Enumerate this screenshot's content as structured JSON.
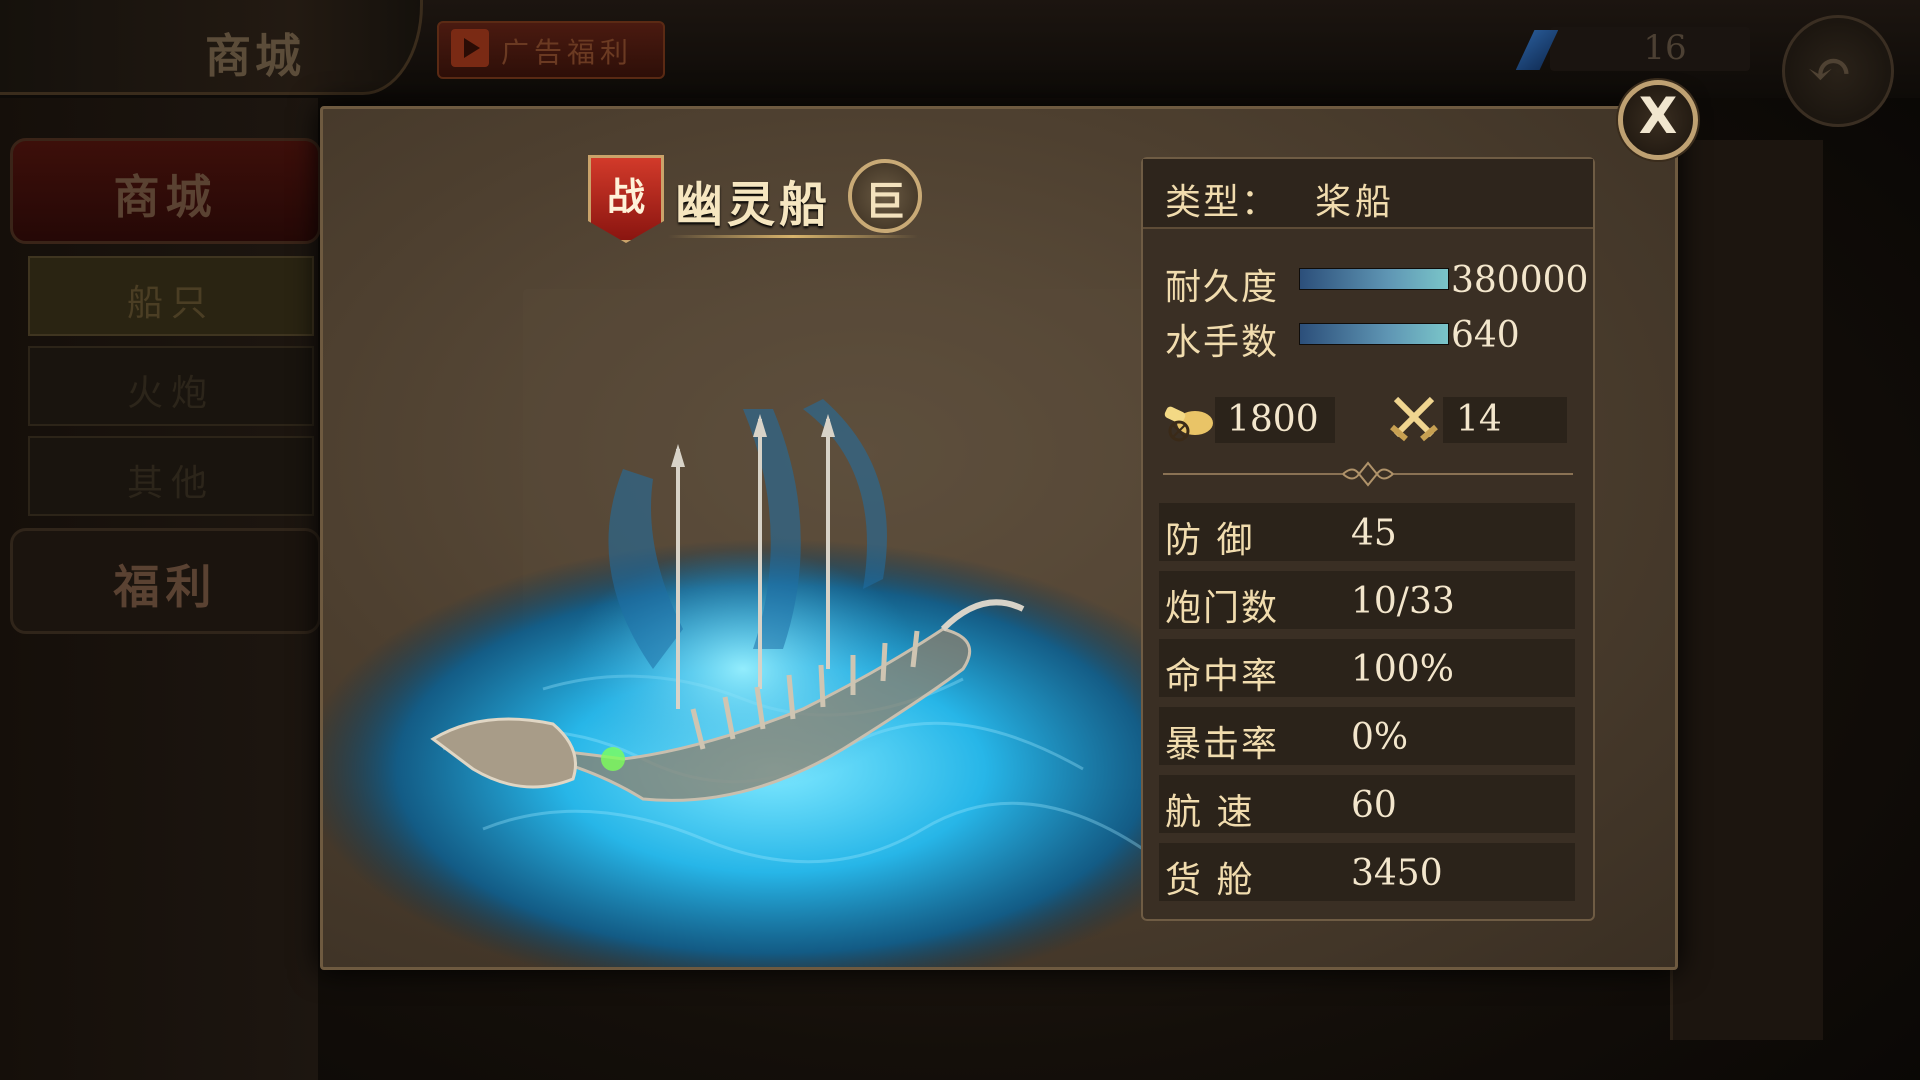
{
  "topbar": {
    "shop_title": "商城",
    "ad_button_label": "广告福利",
    "gem_count": "16"
  },
  "left_nav": {
    "main_label": "商城",
    "items": [
      {
        "label": "船只",
        "active": true
      },
      {
        "label": "火炮",
        "active": false
      },
      {
        "label": "其他",
        "active": false
      }
    ],
    "welfare_label": "福利"
  },
  "dialog": {
    "war_badge": "战",
    "ship_name": "幽灵船",
    "size_badge": "巨",
    "stats": {
      "type_label": "类型：",
      "type_value": "桨船",
      "durability_label": "耐久度",
      "durability_value": "380000",
      "durability_fill": 1.0,
      "sailors_label": "水手数",
      "sailors_value": "640",
      "sailors_fill": 1.0,
      "cannon_value": "1800",
      "melee_value": "14",
      "attributes": [
        {
          "label": "防  御",
          "value": "45"
        },
        {
          "label": "炮门数",
          "value": "10/33"
        },
        {
          "label": "命中率",
          "value": "100%"
        },
        {
          "label": "暴击率",
          "value": "0%"
        },
        {
          "label": "航  速",
          "value": "60"
        },
        {
          "label": "货  舱",
          "value": "3450"
        }
      ]
    }
  },
  "colors": {
    "accent_gold": "#d8b46c",
    "text_cream": "#f1dcae",
    "water_glow": "#3ec3ef",
    "badge_red": "#c23022"
  },
  "icons": {
    "close": "close-icon",
    "back": "back-arrow-icon",
    "gem": "gem-icon",
    "cannon": "cannon-icon",
    "melee": "crossed-swords-icon"
  }
}
